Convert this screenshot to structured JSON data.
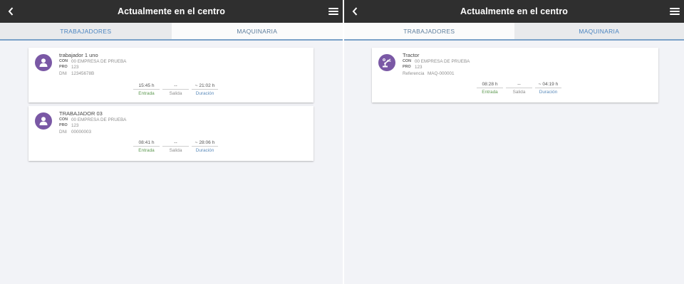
{
  "colors": {
    "topbar": "#2f2f2f",
    "avatar": "#7a58a5",
    "entrada": "#5d9950",
    "duracion": "#5b8bbb"
  },
  "left_screen": {
    "title": "Actualmente en el centro",
    "back_icon": "chevron-left-icon",
    "menu_icon": "hamburger-menu-icon",
    "tabs": [
      {
        "label": "TRABAJADORES",
        "active": true
      },
      {
        "label": "MAQUINARIA",
        "active": false
      }
    ],
    "cards": [
      {
        "icon": "person-icon",
        "name": "trabajador 1 uno",
        "con_label": "CON",
        "con_value": "00 EMPRESA DE PRUEBA",
        "pro_label": "PRO",
        "pro_value": "123",
        "id_label": "DNI",
        "id_value": "12345678B",
        "entrada": "15:45 h",
        "salida": "--",
        "duracion": "~ 21:02 h",
        "entrada_label": "Entrada",
        "salida_label": "Salida",
        "duracion_label": "Duración"
      },
      {
        "icon": "person-icon",
        "name": "TRABAJADOR 03",
        "con_label": "CON",
        "con_value": "00 EMPRESA DE PRUEBA",
        "pro_label": "PRO",
        "pro_value": "123",
        "id_label": "DNI",
        "id_value": "00000003",
        "entrada": "08:41 h",
        "salida": "--",
        "duracion": "~ 28:06 h",
        "entrada_label": "Entrada",
        "salida_label": "Salida",
        "duracion_label": "Duración"
      }
    ]
  },
  "right_screen": {
    "title": "Actualmente en el centro",
    "back_icon": "chevron-left-icon",
    "menu_icon": "hamburger-menu-icon",
    "tabs": [
      {
        "label": "TRABAJADORES",
        "active": false
      },
      {
        "label": "MAQUINARIA",
        "active": true
      }
    ],
    "cards": [
      {
        "icon": "robot-arm-icon",
        "name": "Tractor",
        "con_label": "CON",
        "con_value": "00 EMPRESA DE PRUEBA",
        "pro_label": "PRO",
        "pro_value": "123",
        "id_label": "Referencia",
        "id_value": "MAQ-000001",
        "entrada": "08:28 h",
        "salida": "--",
        "duracion": "~ 04:19 h",
        "entrada_label": "Entrada",
        "salida_label": "Salida",
        "duracion_label": "Duración"
      }
    ]
  }
}
